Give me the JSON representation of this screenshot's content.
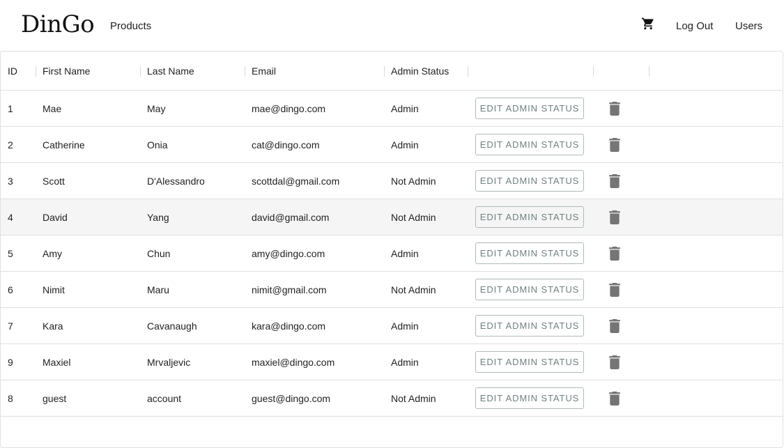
{
  "nav": {
    "logo": "DinGo",
    "products": "Products",
    "logout": "Log Out",
    "users": "Users",
    "cart_icon": "shopping-cart-icon"
  },
  "table": {
    "columns": [
      "ID",
      "First Name",
      "Last Name",
      "Email",
      "Admin Status",
      "",
      ""
    ],
    "rows": [
      {
        "id": "1",
        "first": "Mae",
        "last": "May",
        "email": "mae@dingo.com",
        "status": "Admin",
        "action": "EDIT ADMIN STATUS",
        "delete_icon": "trash-icon"
      },
      {
        "id": "2",
        "first": "Catherine",
        "last": "Onia",
        "email": "cat@dingo.com",
        "status": "Admin",
        "action": "EDIT ADMIN STATUS",
        "delete_icon": "trash-icon"
      },
      {
        "id": "3",
        "first": "Scott",
        "last": "D'Alessandro",
        "email": "scottdal@gmail.com",
        "status": "Not Admin",
        "action": "EDIT ADMIN STATUS",
        "delete_icon": "trash-icon"
      },
      {
        "id": "4",
        "first": "David",
        "last": "Yang",
        "email": "david@gmail.com",
        "status": "Not Admin",
        "action": "EDIT ADMIN STATUS",
        "delete_icon": "trash-icon"
      },
      {
        "id": "5",
        "first": "Amy",
        "last": "Chun",
        "email": "amy@dingo.com",
        "status": "Admin",
        "action": "EDIT ADMIN STATUS",
        "delete_icon": "trash-icon"
      },
      {
        "id": "6",
        "first": "Nimit",
        "last": "Maru",
        "email": "nimit@gmail.com",
        "status": "Not Admin",
        "action": "EDIT ADMIN STATUS",
        "delete_icon": "trash-icon"
      },
      {
        "id": "7",
        "first": "Kara",
        "last": "Cavanaugh",
        "email": "kara@dingo.com",
        "status": "Admin",
        "action": "EDIT ADMIN STATUS",
        "delete_icon": "trash-icon"
      },
      {
        "id": "9",
        "first": "Maxiel",
        "last": "Mrvaljevic",
        "email": "maxiel@dingo.com",
        "status": "Admin",
        "action": "EDIT ADMIN STATUS",
        "delete_icon": "trash-icon"
      },
      {
        "id": "8",
        "first": "guest",
        "last": "account",
        "email": "guest@dingo.com",
        "status": "Not Admin",
        "action": "EDIT ADMIN STATUS",
        "delete_icon": "trash-icon"
      }
    ],
    "hovered_row_id": "4"
  },
  "colors": {
    "button_text": "#6f8080",
    "button_border": "#b0b8b8",
    "icon": "#757575",
    "row_hover": "#f5f5f5",
    "border": "#e0e0e0"
  }
}
